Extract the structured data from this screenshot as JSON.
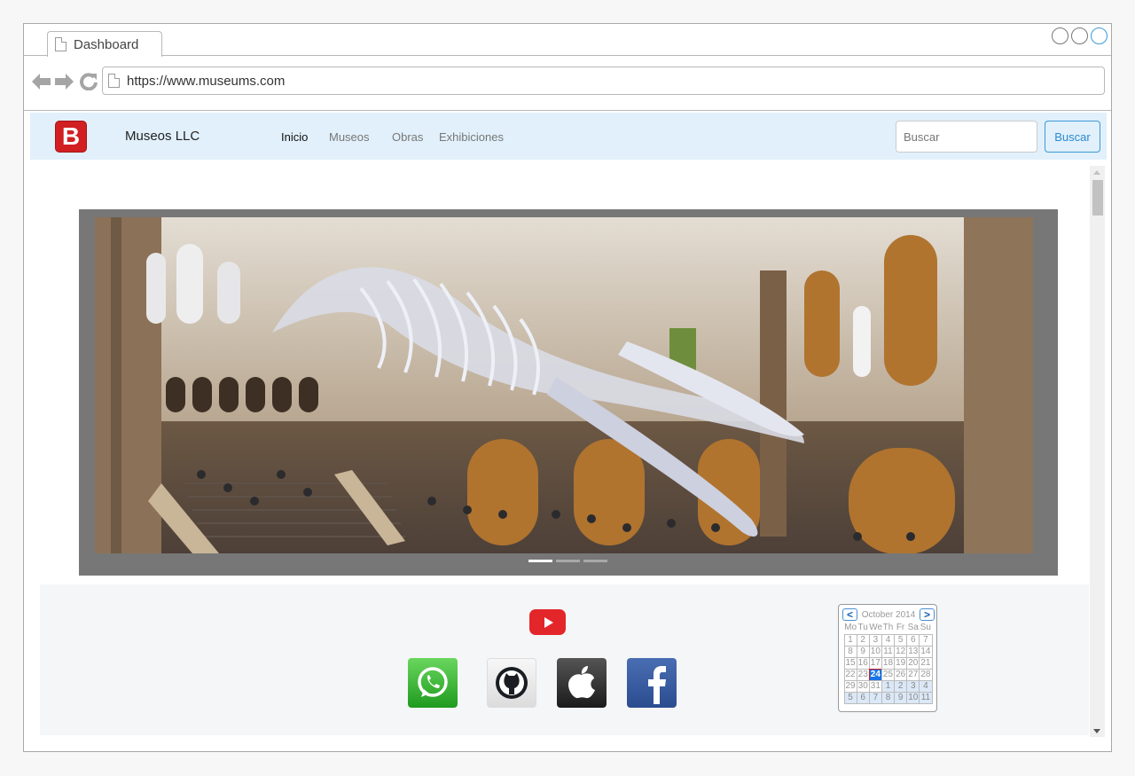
{
  "browser": {
    "tab_title": "Dashboard",
    "url": "https://www.museums.com"
  },
  "navbar": {
    "logo_letter": "B",
    "brand": "Museos LLC",
    "menu": [
      {
        "label": "Inicio",
        "active": true
      },
      {
        "label": "Museos",
        "active": false
      },
      {
        "label": "Obras",
        "active": false
      },
      {
        "label": "Exhibiciones",
        "active": false
      }
    ],
    "search_placeholder": "Buscar",
    "search_button": "Buscar"
  },
  "carousel": {
    "slides": 3,
    "active_slide": 1
  },
  "social": {
    "icons": [
      "youtube-icon",
      "whatsapp-icon",
      "github-icon",
      "apple-icon",
      "facebook-icon"
    ]
  },
  "calendar": {
    "title": "October 2014",
    "prev": "<",
    "next": ">",
    "weekdays": [
      "Mo",
      "Tu",
      "We",
      "Th",
      "Fr",
      "Sa",
      "Su"
    ],
    "weeks": [
      [
        "1",
        "2",
        "3",
        "4",
        "5",
        "6",
        "7"
      ],
      [
        "8",
        "9",
        "10",
        "11",
        "12",
        "13",
        "14"
      ],
      [
        "15",
        "16",
        "17",
        "18",
        "19",
        "20",
        "21"
      ],
      [
        "22",
        "23",
        "24",
        "25",
        "26",
        "27",
        "28"
      ],
      [
        "29",
        "30",
        "31",
        "1",
        "2",
        "3",
        "4"
      ],
      [
        "5",
        "6",
        "7",
        "8",
        "9",
        "10",
        "11"
      ]
    ],
    "today": "24"
  },
  "colors": {
    "navbar_bg": "#e1f0fb",
    "logo_red": "#d11f22",
    "accent_blue": "#2a8ad0"
  }
}
